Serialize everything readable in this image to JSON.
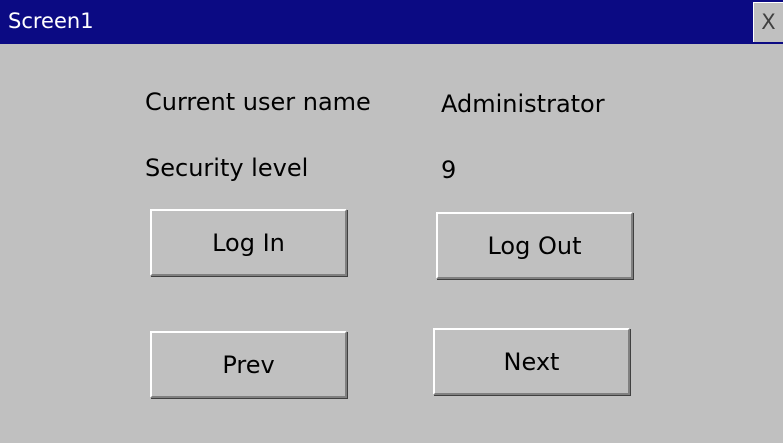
{
  "window": {
    "title": "Screen1",
    "close_label": "X"
  },
  "fields": {
    "current_user_label": "Current user name",
    "current_user_value": "Administrator",
    "security_level_label": "Security level",
    "security_level_value": "9"
  },
  "buttons": {
    "log_in": "Log In",
    "log_out": "Log Out",
    "prev": "Prev",
    "next": "Next"
  },
  "colors": {
    "titlebar": "#0b0a83",
    "background": "#c0c0c0"
  }
}
